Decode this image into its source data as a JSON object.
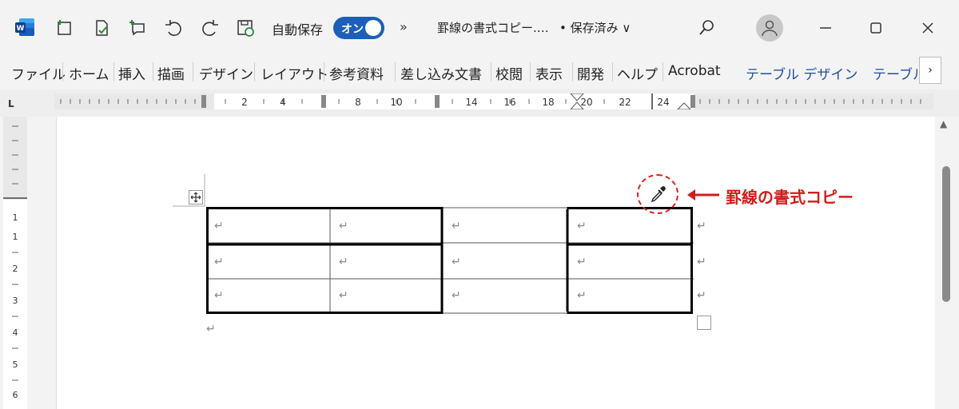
{
  "titlebar": {
    "autosave_label": "自動保存",
    "autosave_state": "オン",
    "more": "»",
    "doc_title": "罫線の書式コピー.…",
    "save_status": "• 保存済み ∨"
  },
  "ribbon": {
    "tabs": [
      "ファイル",
      "ホーム",
      "挿入",
      "描画",
      "デザイン",
      "レイアウト",
      "参考資料",
      "差し込み文書",
      "校閲",
      "表示",
      "開発",
      "ヘルプ",
      "Acrobat"
    ],
    "context_tabs": [
      "テーブル デザイン",
      "テーブル"
    ],
    "more": "›"
  },
  "ruler": {
    "corner": "L",
    "h_labels": [
      "2",
      "4",
      "8",
      "10",
      "14",
      "16",
      "18",
      "20",
      "22",
      "24"
    ],
    "v_labels": [
      "1",
      "1",
      "2",
      "3",
      "4",
      "5",
      "6"
    ]
  },
  "table": {
    "rows": 3,
    "cols": 4,
    "cell_mark": "↵",
    "row_end_mark": "↵",
    "after_mark": "↵"
  },
  "annotation": {
    "text": "罫線の書式コピー",
    "arrow": "←"
  },
  "colors": {
    "accent": "#1b5fb8",
    "annotation": "#d21c1c"
  }
}
